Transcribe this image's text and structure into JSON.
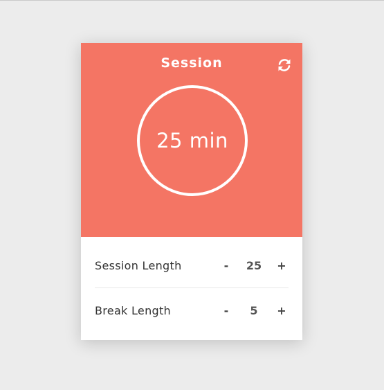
{
  "colors": {
    "accent": "#f47564",
    "page_background": "#ececec",
    "card_background": "#ffffff",
    "label_text": "#333333"
  },
  "header": {
    "mode_title": "Session",
    "reset_icon": "refresh-icon"
  },
  "timer": {
    "display": "25 min"
  },
  "settings": {
    "session": {
      "label": "Session Length",
      "decrement": "-",
      "value": "25",
      "increment": "+"
    },
    "break": {
      "label": "Break Length",
      "decrement": "-",
      "value": "5",
      "increment": "+"
    }
  }
}
